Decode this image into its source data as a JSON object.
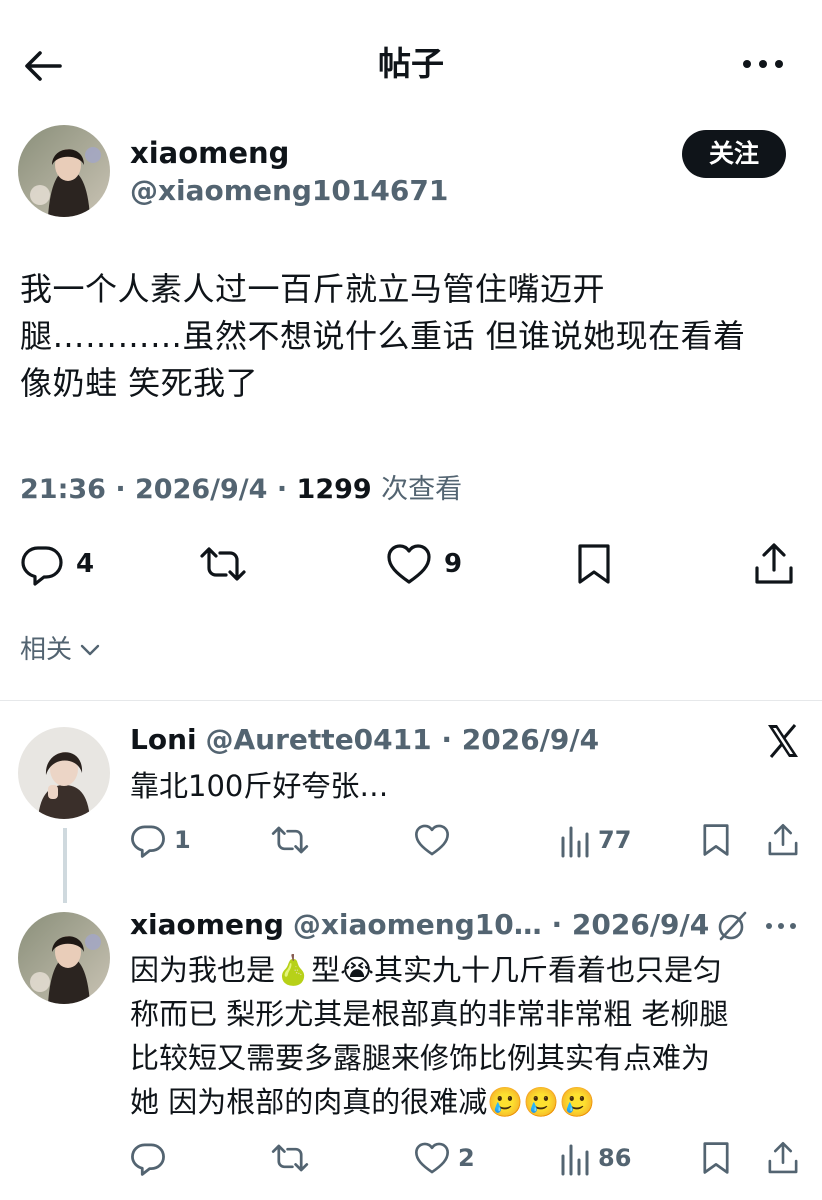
{
  "header": {
    "title": "帖子"
  },
  "post": {
    "author_name": "xiaomeng",
    "author_handle": "@xiaomeng1014671",
    "follow_label": "关注",
    "text_line1": "我一个人素人过一百斤就立马管住嘴迈开",
    "text_line2": "腿…………虽然不想说什么重话 但谁说她现在看着",
    "text_line3": "像奶蛙 笑死我了",
    "time": "21:36",
    "date": "2026/9/4",
    "views": "1299",
    "views_label": "次查看",
    "replies": "4",
    "likes": "9",
    "related_label": "相关"
  },
  "replies": [
    {
      "name": "Loni",
      "handle": "@Aurette0411",
      "date": "2026/9/4",
      "text": "靠北100斤好夸张…",
      "reply_count": "1",
      "views": "77"
    },
    {
      "name": "xiaomeng",
      "handle": "@xiaomeng10…",
      "date": "2026/9/4",
      "text_line1": "因为我也是🍐型😭其实九十几斤看着也只是匀",
      "text_line2": "称而已 梨形尤其是根部真的非常非常粗 老柳腿",
      "text_line3": "比较短又需要多露腿来修饰比例其实有点难为",
      "text_line4": "她 因为根部的肉真的很难减🥲🥲🥲",
      "likes": "2",
      "views": "86"
    }
  ],
  "icons": {
    "back": "arrow-left-icon",
    "more": "more-horizontal-icon",
    "reply": "reply-icon",
    "retweet": "retweet-icon",
    "like": "heart-icon",
    "bookmark": "bookmark-icon",
    "share": "share-icon",
    "views": "views-bar-icon",
    "x_logo": "x-logo-icon",
    "grok": "grok-icon"
  },
  "colors": {
    "text": "#0f1419",
    "secondary": "#536471",
    "follow_bg": "#0f1419",
    "divider": "#e6e8ea"
  }
}
